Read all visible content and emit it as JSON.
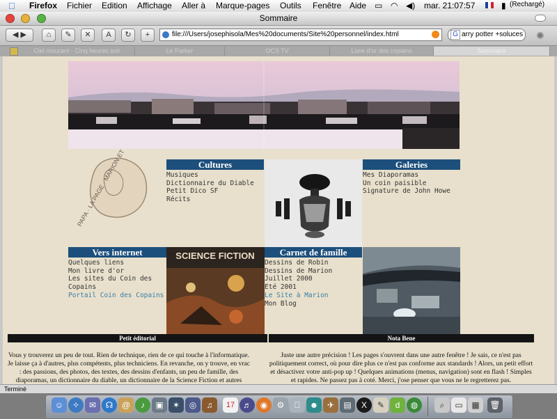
{
  "menubar": {
    "apple": "",
    "app_name": "Firefox",
    "items": [
      "Fichier",
      "Edition",
      "Affichage",
      "Aller à",
      "Marque-pages",
      "Outils",
      "Fenêtre",
      "Aide"
    ],
    "clock": "mar. 21:07:57",
    "battery": "(Rechargé)"
  },
  "window": {
    "title": "Sommaire",
    "url": "file:///Users/josephisola/Mes%20documents/Site%20personnel/index.html",
    "search_value": "arry potter +soluces",
    "tabs": [
      "Ciel mourant - Cinq heures soir",
      "Le Parker",
      "OCS TV",
      "Livre d'or des copains",
      "Sommaire"
    ],
    "status": "Terminé"
  },
  "page": {
    "sections": {
      "cultures": {
        "title": "Cultures",
        "items": [
          "Musiques",
          "Dictionnaire du Diable",
          "Petit Dico SF",
          "Récits"
        ]
      },
      "galeries": {
        "title": "Galeries",
        "items": [
          "Mes Diaporamas",
          "Un coin paisible",
          "Signature de John Howe"
        ]
      },
      "internet": {
        "title": "Vers internet",
        "items": [
          "Quelques liens",
          "Mon livre d'or",
          "Les sites du Coin des Copains"
        ],
        "link": "Portail Coin des Copains"
      },
      "famille": {
        "title": "Carnet de famille",
        "items": [
          "Dessins de Robin",
          "Dessins de Marion",
          "Juillet 2000",
          "Eté 2001"
        ],
        "link": "Le Site à Marion",
        "last": "Mon Blog"
      }
    },
    "logo_text": "PAPA · LA PAGE · MARION ET",
    "sf_cover_title": "SCIENCE FICTION",
    "editorial": {
      "title": "Petit éditorial",
      "text": "Vous y trouverez un peu de tout. Rien de technique, rien de ce qui touche à l'informatique. Je laisse ça à d'autres, plus compétents, plus techniciens. En revanche, on y trouve, en vrac : des passions, des photos, des textes, des dessins d'enfants, un peu de famille, des diaporamas, un dictionnaire du diable, un dictionnaire de la Science Fiction et autres mauvais genres..."
    },
    "nota_bene": {
      "title": "Nota Bene",
      "text": "Juste une autre précision ! Les pages s'ouvrent dans une autre fenêtre ! Je sais, ce n'est pas politiquement correct, où pour dire plus ce n'est pas conforme aux standards ! Alors, un petit effort et désactivez votre anti-pop up ! Quelques animations (menus, navigation) sont en flash ! Simples et rapides. Ne passez pas à coté. Merci, j'ose penser que vous ne le regretterez pas."
    }
  },
  "dock": {
    "calendar_day": "17"
  }
}
